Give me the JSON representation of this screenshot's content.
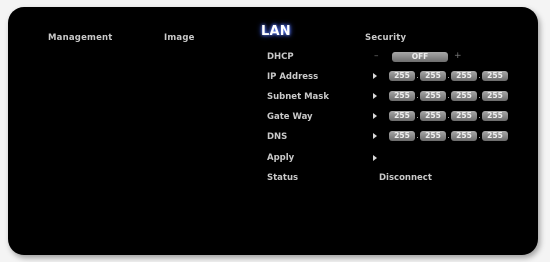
{
  "tabs": {
    "management": "Management",
    "image": "Image",
    "lan": "LAN",
    "security": "Security"
  },
  "rows": {
    "dhcp": {
      "label": "DHCP",
      "minus": "–",
      "value": "OFF",
      "plus": "+"
    },
    "ip_address": {
      "label": "IP Address",
      "octets": [
        "255",
        "255",
        "255",
        "255"
      ]
    },
    "subnet_mask": {
      "label": "Subnet Mask",
      "octets": [
        "255",
        "255",
        "255",
        "255"
      ]
    },
    "gateway": {
      "label": "Gate Way",
      "octets": [
        "255",
        "255",
        "255",
        "255"
      ]
    },
    "dns": {
      "label": "DNS",
      "octets": [
        "255",
        "255",
        "255",
        "255"
      ]
    },
    "apply": {
      "label": "Apply"
    },
    "status": {
      "label": "Status",
      "value": "Disconnect"
    }
  },
  "separator": ".",
  "icons": {
    "row_arrow": "triangle-right-icon"
  },
  "colors": {
    "background": "#000000",
    "text": "#c9c9c9",
    "active_tab_glow": "#6a8cff",
    "field": "#8a8a8a"
  }
}
